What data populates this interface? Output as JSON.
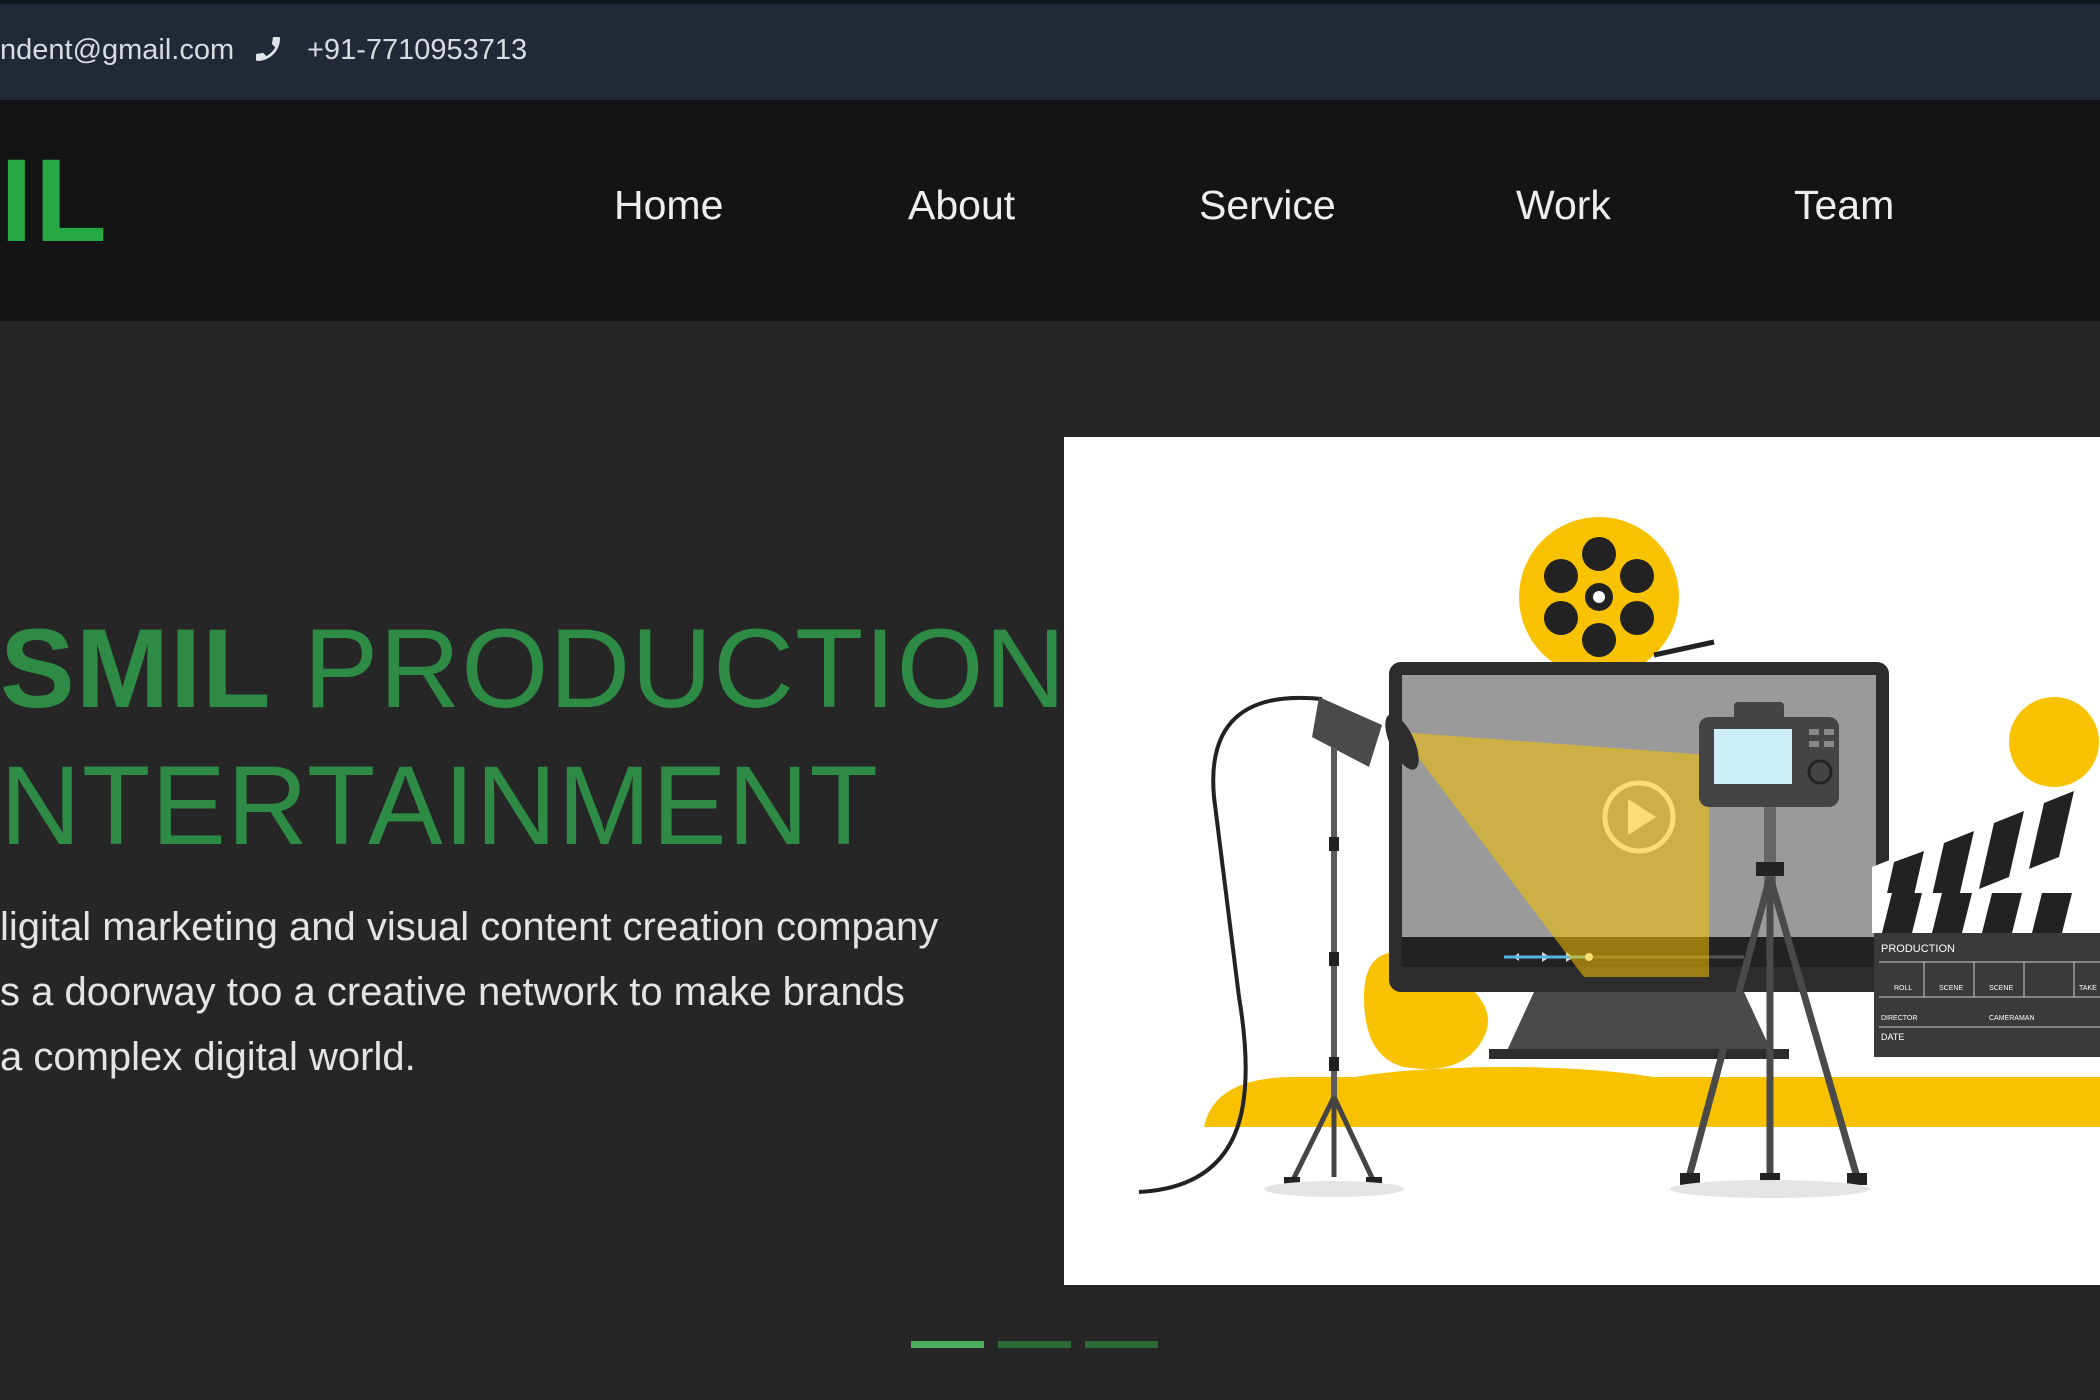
{
  "topbar": {
    "email": "ndent@gmail.com",
    "phone_icon": "phone-icon",
    "phone": "+91-7710953713"
  },
  "navbar": {
    "logo": "IL",
    "logo_color": "#26a944",
    "items": [
      {
        "label": "Home"
      },
      {
        "label": "About"
      },
      {
        "label": "Service"
      },
      {
        "label": "Work"
      },
      {
        "label": "Team"
      }
    ]
  },
  "hero": {
    "title_brand": "SMIL",
    "title_rest": "PRODUCTION",
    "title_line2": "NTERTAINMENT",
    "description": [
      "ligital marketing and visual content creation company",
      "s a doorway too a creative network to make brands",
      "a complex digital world."
    ],
    "illustration": {
      "clapper_title": "PRODUCTION",
      "clapper_fields": [
        "ROLL",
        "SCENE",
        "SCENE",
        "TAKE"
      ],
      "clapper_director": "DIRECTOR",
      "clapper_cameraman": "CAMERAMAN",
      "clapper_date": "DATE"
    }
  },
  "carousel": {
    "active_index": 0,
    "count": 3
  },
  "colors": {
    "accent_green": "#2e8b45",
    "topbar_bg": "#212836",
    "navbar_bg": "#141414",
    "page_bg": "#262626",
    "yellow": "#f8c200"
  }
}
